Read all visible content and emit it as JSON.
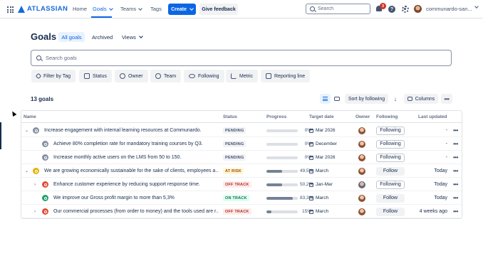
{
  "topnav": {
    "logo": "ATLASSIAN",
    "links": [
      "Home",
      "Goals",
      "Teams",
      "Tags"
    ],
    "create_label": "Create",
    "feedback_label": "Give feedback",
    "search_placeholder": "Search",
    "notification_count": "3",
    "help_glyph": "?",
    "user_name": "communardo-san..."
  },
  "page": {
    "title": "Goals",
    "tabs": [
      "All goals",
      "Archived",
      "Views"
    ],
    "search_placeholder": "Search goals"
  },
  "filters": [
    "Filter by Tag",
    "Status",
    "Owner",
    "Team",
    "Following",
    "Metric",
    "Reporting line"
  ],
  "toolbar": {
    "count": "13 goals",
    "sort_label": "Sort by following",
    "sort_dir": "↓",
    "columns_label": "Columns",
    "more": "•••"
  },
  "table": {
    "headers": [
      "Name",
      "Status",
      "Progress",
      "Target date",
      "Owner",
      "Following",
      "Last updated"
    ],
    "rows": [
      {
        "caret": "⌄",
        "name": "Increase engagement with internal learning resources at Communardo.",
        "status": "PENDING",
        "progress": "0%",
        "fill": 0,
        "date": "Mar 2026",
        "following": "Following",
        "updated": "-",
        "icon_color": "#8590a2",
        "level": 0
      },
      {
        "caret": "",
        "name": "Achieve 80% completion rate for mandatory training courses by Q3.",
        "status": "PENDING",
        "progress": "0%",
        "fill": 0,
        "date": "December",
        "following": "Following",
        "updated": "-",
        "icon_color": "#8590a2",
        "level": 1
      },
      {
        "caret": "",
        "name": "Increase monthly active users on the LMS from 50 to 150.",
        "status": "PENDING",
        "progress": "0%",
        "fill": 0,
        "date": "Mar 2026",
        "following": "Following",
        "updated": "-",
        "icon_color": "#8590a2",
        "level": 1
      },
      {
        "caret": "⌄",
        "name": "We are growing economically sustainable for the sake of clients, employees a...",
        "status": "AT RISK",
        "progress": "49,5%",
        "fill": 0.495,
        "date": "March",
        "following": "Follow",
        "updated": "Today",
        "icon_color": "#e2b203",
        "level": 0
      },
      {
        "caret": "›",
        "name": "Enhance customer experience by reducing support response time.",
        "status": "OFF TRACK",
        "progress": "50,2%",
        "fill": 0.502,
        "date": "Jan-Mar",
        "following": "Following",
        "updated": "Today",
        "icon_color": "#e34935",
        "level": 1
      },
      {
        "caret": "",
        "name": "We improve our Gross profit margin to more than 5,3%",
        "status": "ON TRACK",
        "progress": "83,3%",
        "fill": 0.833,
        "date": "March",
        "following": "Follow",
        "updated": "Today",
        "icon_color": "#22a06b",
        "level": 1
      },
      {
        "caret": "›",
        "name": "Our commercial processes (from order to money) and the tools used are r...",
        "status": "OFF TRACK",
        "progress": "15%",
        "fill": 0.15,
        "date": "March",
        "following": "Follow",
        "updated": "4 weeks ago",
        "icon_color": "#e34935",
        "level": 1
      }
    ]
  },
  "colors": {
    "brand": "#1868db",
    "accent": "#0c66e4",
    "pending_bg": "#f1f2f4",
    "pending_fg": "#44546f",
    "atrisk_bg": "#fff7d6",
    "atrisk_fg": "#a54800",
    "offtrack_bg": "#ffeceb",
    "offtrack_fg": "#ae2e24",
    "ontrack_bg": "#dcfff1",
    "ontrack_fg": "#216e4e",
    "progress_fill": "#758195"
  },
  "icons": [
    "grid-icon",
    "atlassian-logo-icon",
    "search-icon",
    "bell-icon",
    "help-icon",
    "settings-icon",
    "tag-icon",
    "status-icon",
    "owner-icon",
    "team-icon",
    "eye-icon",
    "metric-icon",
    "reporting-line-icon",
    "list-view-icon",
    "board-view-icon",
    "columns-icon",
    "more-icon",
    "calendar-icon",
    "goal-icon"
  ]
}
